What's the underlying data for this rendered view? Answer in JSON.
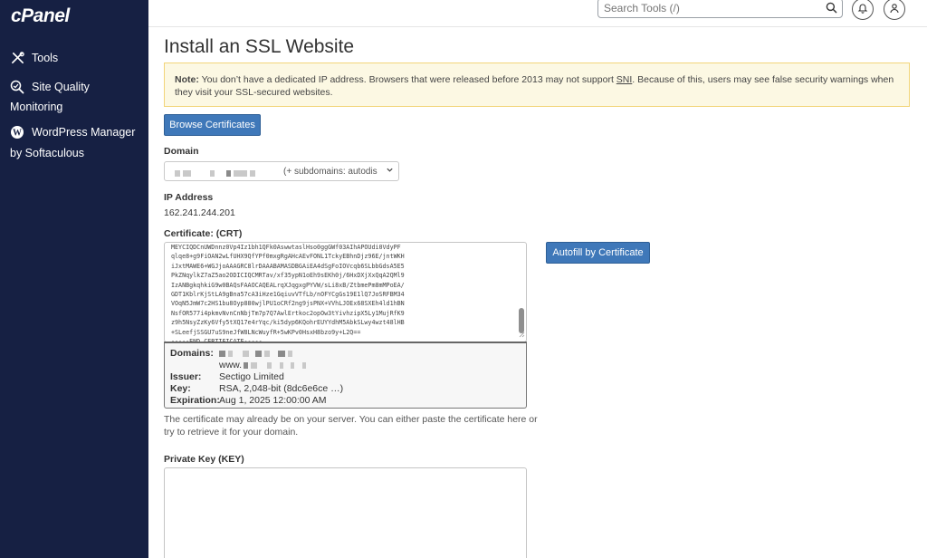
{
  "sidebar": {
    "logo": "cPanel",
    "items": [
      {
        "icon": "tools-icon",
        "label": "Tools"
      },
      {
        "icon": "site-quality-icon",
        "label": "Site Quality",
        "sub": "Monitoring"
      },
      {
        "icon": "wordpress-icon",
        "label": "WordPress Manager",
        "sub": "by Softaculous"
      }
    ]
  },
  "topbar": {
    "search_placeholder": "Search Tools (/)",
    "search_icon": "search-icon",
    "notifications_icon": "bell-icon",
    "user_icon": "user-icon"
  },
  "page": {
    "title": "Install an SSL Website",
    "note_label": "Note:",
    "note_text_1": " You don’t have a dedicated IP address. Browsers that were released before 2013 may not support ",
    "note_sni": "SNI",
    "note_text_2": ". Because of this, users may see false security warnings when they visit your SSL-secured websites.",
    "browse_button": "Browse Certificates",
    "domain_label": "Domain",
    "domain_select_suffix": "(+ subdomains: autodis",
    "ip_label": "IP Address",
    "ip_value": "162.241.244.201",
    "crt_label": "Certificate: (CRT)",
    "crt_text": "MEYCIQDCnUWDnnz0Vp4Iz1bh1QFk0AswwtaslHso0ggGWf03AIhAPOUdi0VdyPF\nqlqe8+g9FiOAN2wLfUHX9QfYPf0mxgRgAHcAEvFONL1TckyEBhnDjz96E/jntWKH\niJxtMAWE6+WGJjoAAAGRC8lrDAAABAMASDBGAiEA4dSgFoIOVcqb6SLbbGdsA5E5\nPkZNqylkZ7aZ5ao2ODICIQCMRTav/xf35ypN1oEh9sEKh0j/6HxDXjXxQqA2QMl9\nIzANBgkqhkiG9w0BAQsFAAOCAQEALrqXJqgxgPYVW/sLi8xB/ZtbmePm8mMPoEA/\nGDT1KblrKjStLA9gBna57cA3iHze1GqiuvVTfLb/nOFYCgGs19E1lQ7JoSRFBM34\nVOqN5JmW7c2HS1bu8Oyp880wjlPU1oCRf2ng9jsPNX+VVhLJOEx68SXEh4ld1hBN\nNsfOR577i4pkmvNvnCnNbjTm7p7Q7AwlErtkoc2opOw3tYivhzipX5Ly1MujRfK9\nz9h5NsyZzKy6Vfy5tXQ17e4rYqc/ki5dyp6KQohrEUYYdhM5AbkSLwy4wzt48lHB\n+SLeefjSSGU7uS9neJfW8LNcWuyfR+5wKPv0HsxH8bzo9y+L2Q==\n-----END CERTIFICATE-----",
    "autofill_button": "Autofill by Certificate",
    "cert_info": {
      "domains_label": "Domains:",
      "domains_www": "www.",
      "issuer_label": "Issuer:",
      "issuer_value": "Sectigo Limited",
      "key_label": "Key:",
      "key_value": "RSA, 2,048-bit (8dc6e6ce …)",
      "expiration_label": "Expiration:",
      "expiration_value": "Aug 1, 2025 12:00:00 AM"
    },
    "help_text": "The certificate may already be on your server. You can either paste the certificate here or try to retrieve it for your domain.",
    "key_label": "Private Key (KEY)"
  },
  "colors": {
    "sidebar_bg": "#162043",
    "primary_button": "#3f78b9",
    "note_bg": "#fcf8e3",
    "note_border": "#f2d57a"
  }
}
